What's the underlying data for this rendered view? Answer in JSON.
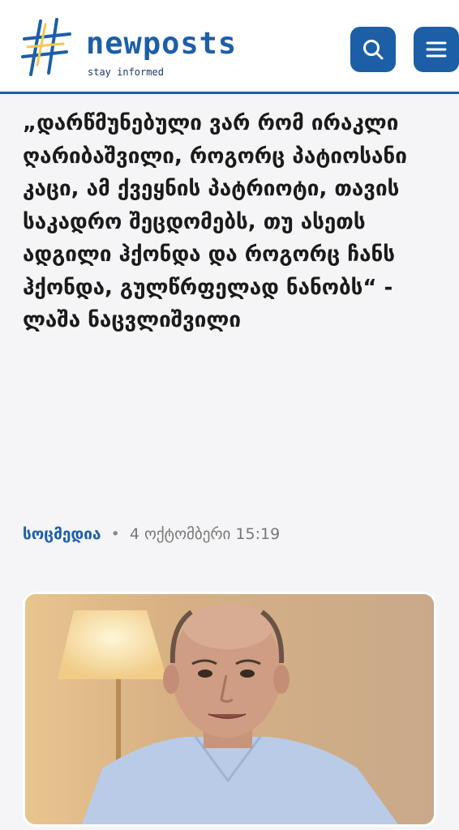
{
  "header": {
    "logo": {
      "name": "newposts",
      "tagline": "stay informed",
      "symbol": "#"
    },
    "search_button": {
      "icon": "search-icon"
    },
    "menu_button": {
      "icon": "hamburger-menu-icon"
    }
  },
  "article": {
    "headline": "„დარწმუნებული ვარ რომ ირაკლი ღარიბაშვილი, როგორც პატიოსანი კაცი, ამ ქვეყნის პატრიოტი, თავის საკადრო შეცდომებს, თუ ასეთს ადგილი ჰქონდა და როგორც ჩანს ჰქონდა, გულწრფელად ნანობს“ - ლაშა ნაცვლიშვილი",
    "source": "სოცმედია",
    "separator": "•",
    "date": "4 ოქტომბერი 15:19",
    "image": {
      "subject": "photo-of-man-in-light-blue-shirt"
    }
  },
  "colors": {
    "brand": "#1c5fa6",
    "accent_yellow": "#f2c94c",
    "page_bg": "#f5f5f7",
    "text": "#1a1a1a",
    "meta_text": "#777777"
  }
}
